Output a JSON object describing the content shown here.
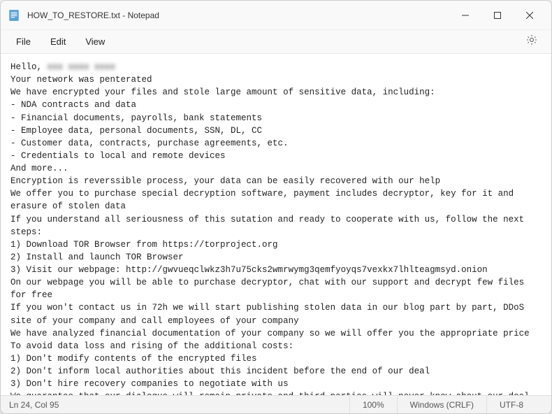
{
  "titlebar": {
    "title": "HOW_TO_RESTORE.txt - Notepad"
  },
  "menu": {
    "file": "File",
    "edit": "Edit",
    "view": "View"
  },
  "content": {
    "hello_prefix": "Hello, ",
    "hello_redacted": "xxx xxxx xxxx",
    "body": "Your network was penterated\nWe have encrypted your files and stole large amount of sensitive data, including:\n- NDA contracts and data\n- Financial documents, payrolls, bank statements\n- Employee data, personal documents, SSN, DL, CC\n- Customer data, contracts, purchase agreements, etc.\n- Credentials to local and remote devices\nAnd more...\nEncryption is reverssible process, your data can be easily recovered with our help\nWe offer you to purchase special decryption software, payment includes decryptor, key for it and erasure of stolen data\nIf you understand all seriousness of this sutation and ready to cooperate with us, follow the next steps:\n1) Download TOR Browser from https://torproject.org\n2) Install and launch TOR Browser\n3) Visit our webpage: http://gwvueqclwkz3h7u75cks2wmrwymg3qemfyoyqs7vexkx7lhlteagmsyd.onion\nOn our webpage you will be able to purchase decryptor, chat with our support and decrypt few files for free\nIf you won't contact us in 72h we will start publishing stolen data in our blog part by part, DDoS site of your company and call employees of your company\nWe have analyzed financial documentation of your company so we will offer you the appropriate price\nTo avoid data loss and rising of the additional costs:\n1) Don't modify contents of the encrypted files\n2) Don't inform local authorities about this incident before the end of our deal\n3) Don't hire recovery companies to negotiate with us\nWe guarantee that our dialogue will remain private and third-parties will never know about our deal\n\\%\\%\\%\\%\\%\\%\\%\\%\\%\\%\\%\\%\\%\\%\\%\\% REDALERT UNIQUE IDENTIFIER START \\%\\%\\%\\%\\%\\%\\%\\%\\%\\%\\%\\%\\%\\%\\%\\%"
  },
  "status": {
    "cursor": "Ln 24, Col 95",
    "zoom": "100%",
    "eol": "Windows (CRLF)",
    "encoding": "UTF-8"
  }
}
